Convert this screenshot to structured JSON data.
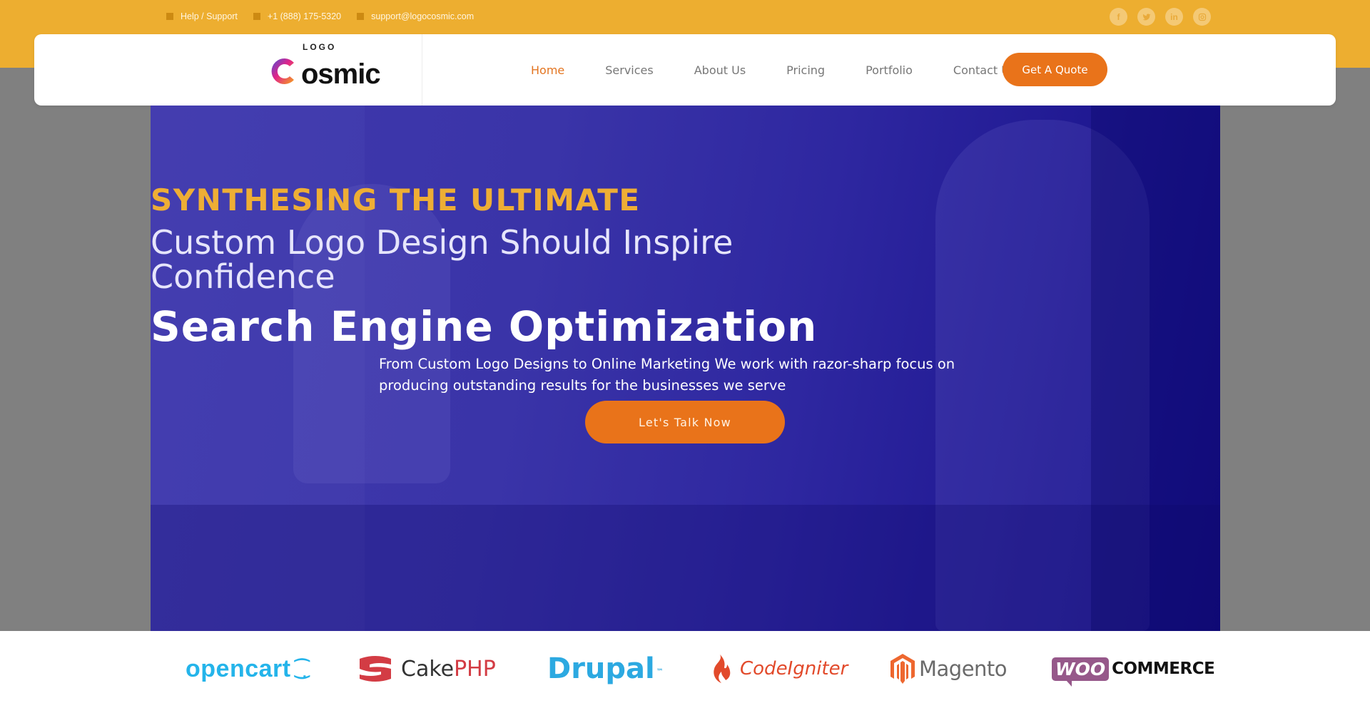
{
  "topbar": {
    "items": [
      {
        "icon": "square-bullet-icon",
        "label": "Help / Support"
      },
      {
        "icon": "square-bullet-icon",
        "label": "+1 (888) 175-5320"
      },
      {
        "icon": "square-bullet-icon",
        "label": "support@logocosmic.com"
      }
    ],
    "socials": [
      {
        "icon": "facebook-icon",
        "glyph": "f"
      },
      {
        "icon": "twitter-icon",
        "glyph": "t"
      },
      {
        "icon": "linkedin-icon",
        "glyph": "in"
      },
      {
        "icon": "instagram-icon",
        "glyph": "◎"
      }
    ]
  },
  "header": {
    "logo_small": "LOGO",
    "logo_big": "osmic",
    "nav": [
      {
        "label": "Home",
        "active": true
      },
      {
        "label": "Services",
        "active": false
      },
      {
        "label": "About Us",
        "active": false
      },
      {
        "label": "Pricing",
        "active": false
      },
      {
        "label": "Portfolio",
        "active": false
      },
      {
        "label": "Contact Us",
        "active": false
      }
    ],
    "cta_label": "Get A Quote"
  },
  "hero": {
    "eyebrow": "SYNTHESING THE ULTIMATE",
    "subtitle_line1": "Custom Logo Design Should Inspire",
    "subtitle_line2": "Confidence",
    "title": "Search Engine Optimization",
    "description": "From Custom Logo Designs to Online Marketing We work with razor-sharp focus on producing outstanding results for the businesses we serve",
    "cta_label": "Let's Talk Now"
  },
  "partners": {
    "opencart": "opencart",
    "cake_a": "Cake",
    "cake_b": "PHP",
    "drupal": "Drupal",
    "drupal_tm": "™",
    "codeigniter": "CodeIgniter",
    "magento": "Magento",
    "woo": "WOO",
    "commerce": "COMMERCE"
  },
  "colors": {
    "topbar": "#edae30",
    "accent_orange": "#e9731a",
    "hero_blue": "#3a34a8",
    "eyebrow_gold": "#eeae35"
  }
}
